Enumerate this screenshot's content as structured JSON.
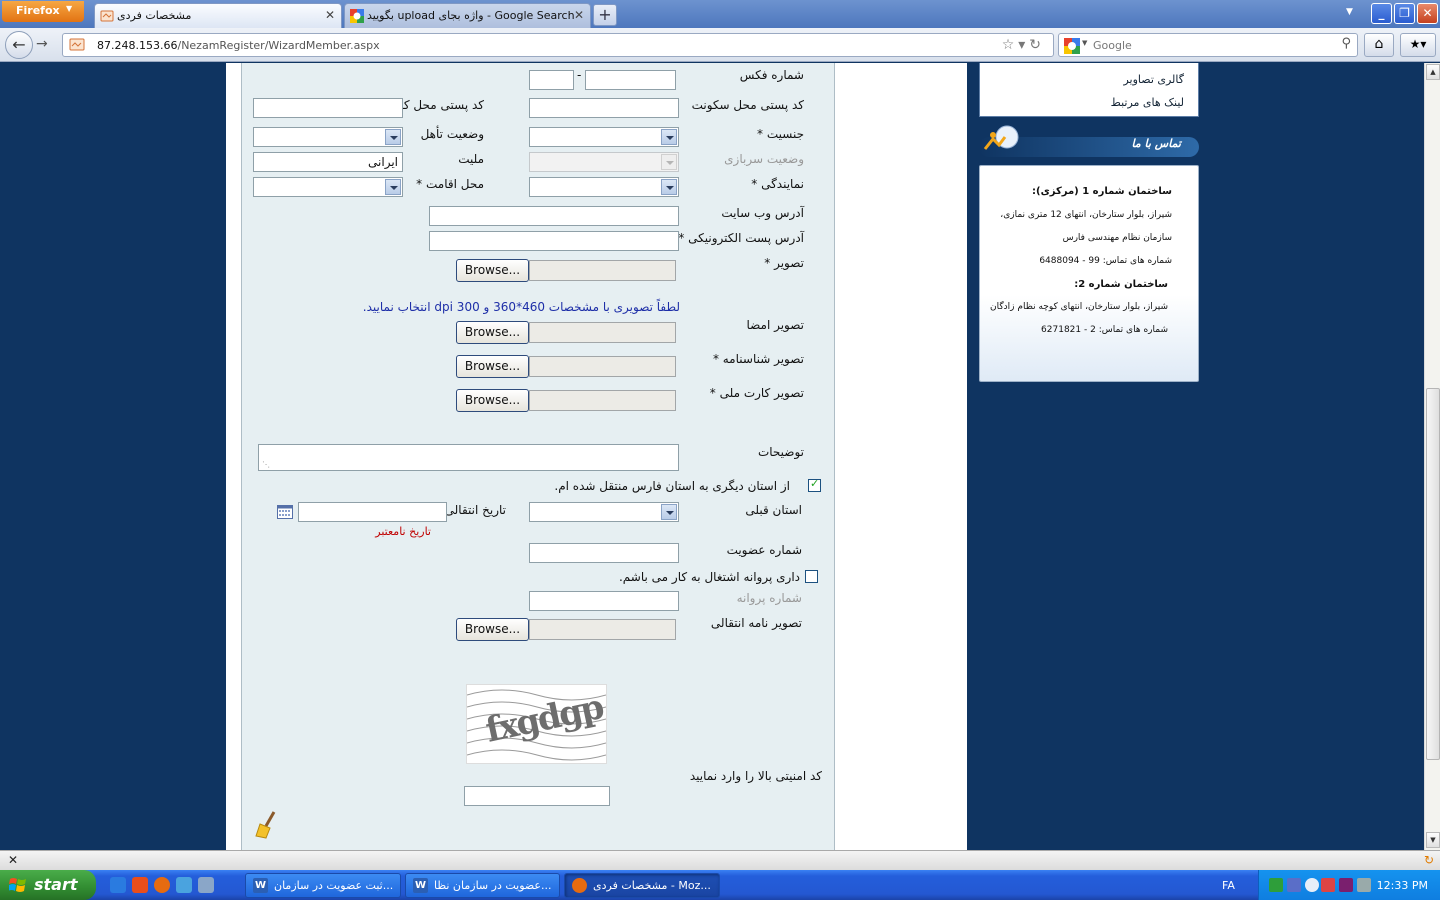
{
  "browser": {
    "menu_label": "Firefox",
    "tabs": [
      {
        "title": "مشخصات فردی",
        "active": true
      },
      {
        "title": "بگوييد upload واژه بجای - Google Search",
        "active": false
      }
    ],
    "new_tab": "+",
    "url_host": "87.248.153.66",
    "url_path": "/NezamRegister/WizardMember.aspx",
    "search_placeholder": "Google"
  },
  "form": {
    "fax_label": "شماره فکس",
    "fax_separator": "-",
    "home_postal_label": "کد پستی محل سکونت",
    "work_postal_label": "کد پستی محل کار",
    "gender_label": "جنسیت *",
    "marital_label": "وضعیت تأهل",
    "military_label": "وضعیت سربازی",
    "nationality_label": "ملیت",
    "nationality_value": "ایرانی",
    "office_label": "نمایندگی *",
    "residence_label": "محل اقامت *",
    "website_label": "آدرس وب سایت",
    "email_label": "آدرس پست الکترونیکی *",
    "photo_label": "تصویر *",
    "browse_label": "Browse...",
    "photo_hint": "لطفاً تصویری با مشخصات 460*360 و dpi 300 انتخاب نمایید.",
    "signature_label": "تصویر امضا",
    "birthcert_label": "تصویر شناسنامه *",
    "idcard_label": "تصویر کارت ملی *",
    "notes_label": "توضیحات",
    "transferred_check": "از استان دیگری به استان فارس منتقل شده ام.",
    "transferred_checked": true,
    "prev_province_label": "استان قبلی",
    "transfer_date_label": "تاریخ انتقالی",
    "date_error": "تاریخ نامعتبر",
    "membership_no_label": "شماره عضویت",
    "license_check": "داری پروانه اشتغال به کار می باشم.",
    "license_checked": false,
    "license_no_label": "شماره پروانه",
    "transfer_letter_label": "تصویر نامه انتقالی",
    "captcha_text": "fxgdgp",
    "captcha_label": "کد امنیتی بالا را وارد نمایید"
  },
  "sidebar": {
    "links": [
      "گالری تصاویر",
      "لینک های مرتبط"
    ],
    "contact_title": "تماس با ما",
    "contact_lines": [
      {
        "text": "ساختمان شماره 1 (مرکزی):",
        "bold": true
      },
      {
        "text": "شیراز، بلوار ستارخان، انتهای 12 متری نمازی،",
        "bold": false
      },
      {
        "text": "سازمان نظام مهندسی فارس",
        "bold": false
      },
      {
        "text": "شماره های تماس: 99 - 6488094",
        "bold": false
      },
      {
        "text": "ساختمان شماره 2:",
        "bold": true
      },
      {
        "text": "شیراز، بلوار ستارخان، انتهای کوچه نظام زادگان",
        "bold": false
      },
      {
        "text": "شماره های تماس: 2 - 6271821",
        "bold": false
      }
    ]
  },
  "taskbar": {
    "start_label": "start",
    "tasks": [
      {
        "label": "ثبت عضویت در سازمان...",
        "icon": "word-icon",
        "active": false
      },
      {
        "label": "عضویت در سازمان نظا...",
        "icon": "word-icon",
        "active": false
      },
      {
        "label": "مشخصات فردی - Moz...",
        "icon": "firefox-icon",
        "active": true
      }
    ],
    "language": "FA",
    "clock": "12:33 PM"
  },
  "colors": {
    "page_bg": "#0f3461",
    "form_bg": "#e6eff2",
    "hint_blue": "#1e2fa8",
    "error_red": "#c00000"
  }
}
